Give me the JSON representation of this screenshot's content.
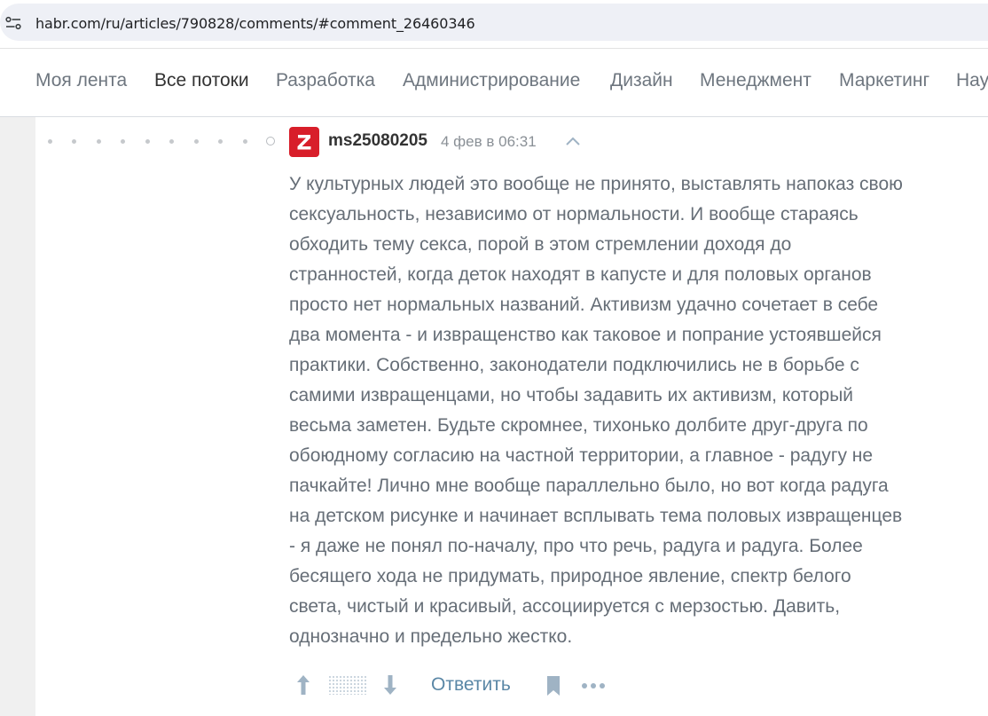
{
  "browser": {
    "url": "habr.com/ru/articles/790828/comments/#comment_26460346"
  },
  "nav": {
    "items": [
      {
        "label": "Моя лента",
        "active": false
      },
      {
        "label": "Все потоки",
        "active": true
      },
      {
        "label": "Разработка",
        "active": false
      },
      {
        "label": "Администрирование",
        "active": false
      },
      {
        "label": "Дизайн",
        "active": false
      },
      {
        "label": "Менеджмент",
        "active": false
      },
      {
        "label": "Маркетинг",
        "active": false
      },
      {
        "label": "Нау",
        "active": false
      }
    ]
  },
  "comment": {
    "avatar_letter": "Z",
    "author": "ms25080205",
    "datetime": "4 фев в 06:31",
    "body_lines": [
      "У культурных людей это вообще не принято, выставлять напоказ свою",
      "сексуальность, независимо от нормальности. И вообще стараясь",
      "обходить тему секса, порой в этом стремлении доходя до",
      "странностей, когда деток находят в капусте и для половых органов",
      "просто нет нормальных названий. Активизм удачно сочетает в себе",
      "два момента - и извращенство как таковое и попрание устоявшейся",
      "практики. Собственно, законодатели подключились не в борьбе с",
      "самими извращенцами, но чтобы задавить их активизм, который",
      "весьма заметен. Будьте скромнее, тихонько долбите друг-друга по",
      "обоюдному согласию на частной территории, а главное - радугу не",
      "пачкайте! Лично мне вообще параллельно было, но вот когда радуга",
      "на детском рисунке и начинает всплывать тема половых извращенцев",
      "- я даже не понял по-началу, про что речь, радуга и радуга. Более",
      "бесящего хода не придумать, природное явление, спектр белого",
      "света, чистый и красивый, ассоциируется с мерзостью. Давить,",
      "однозначно и предельно жестко."
    ],
    "reply_label": "Ответить"
  },
  "colors": {
    "avatar_bg": "#d81e2a",
    "link": "#5a87a6",
    "vote_icon": "#9fb3c4"
  }
}
